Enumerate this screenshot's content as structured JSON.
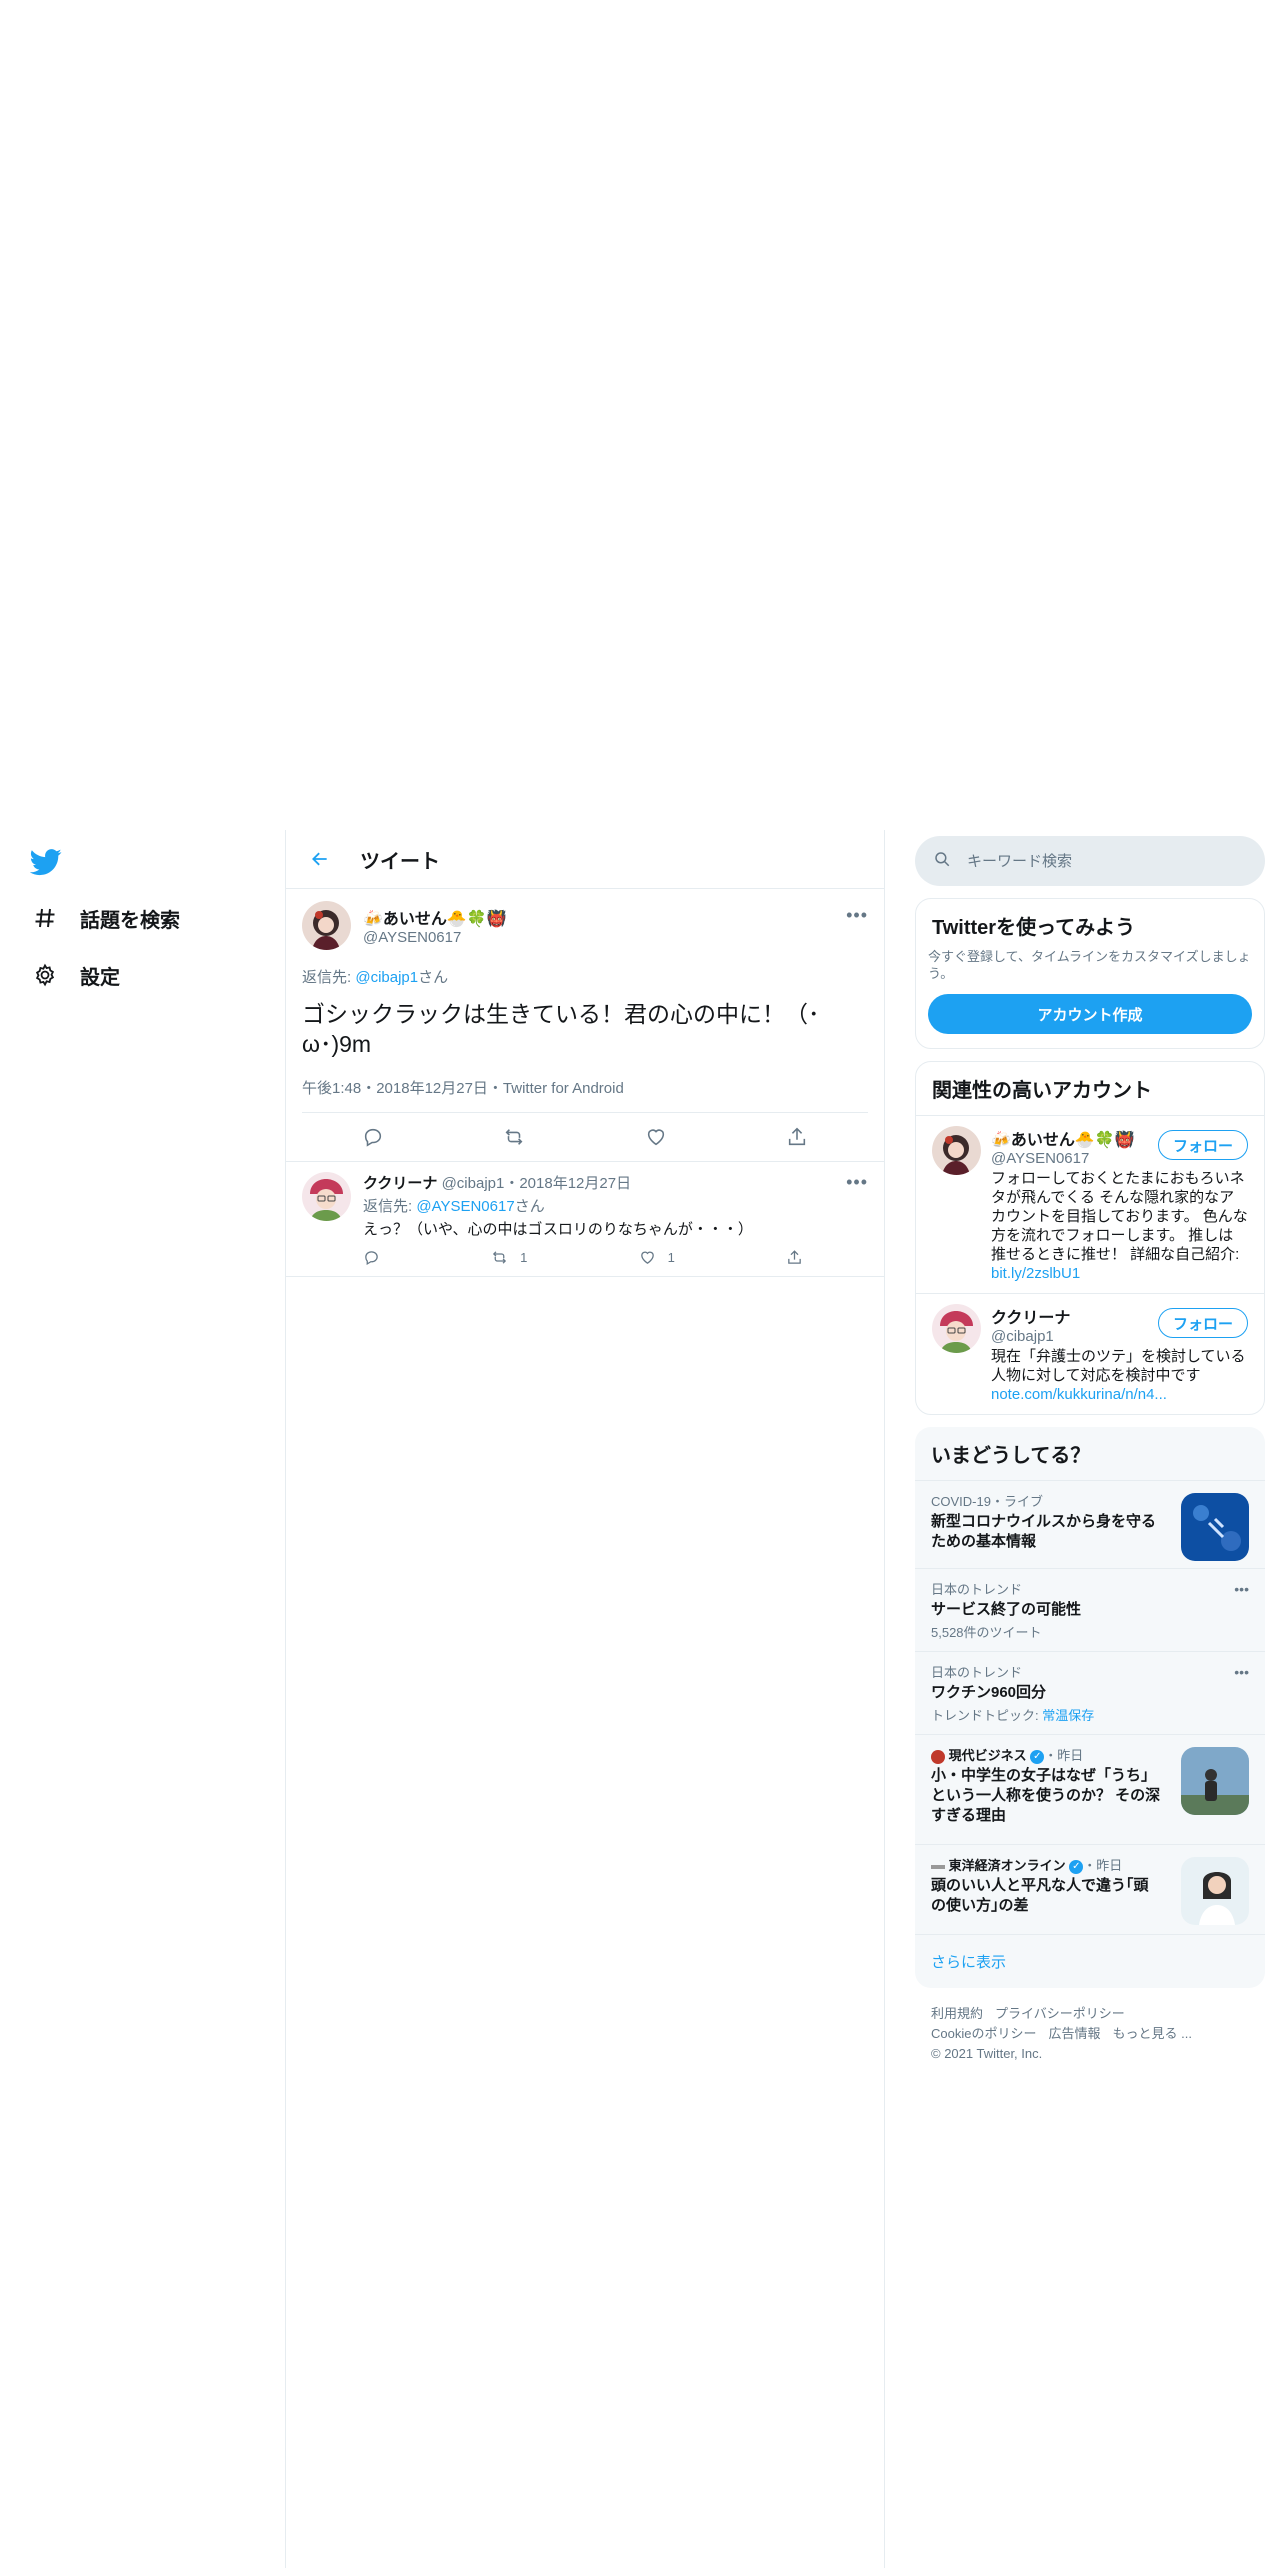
{
  "nav": {
    "explore_label": "話題を検索",
    "settings_label": "設定"
  },
  "header": {
    "title": "ツイート"
  },
  "main_tweet": {
    "name": "🍻あいせん🐣🍀👹",
    "handle": "@AYSEN0617",
    "reply_prefix": "返信先: ",
    "reply_user": "@cibajp1",
    "reply_suffix": "さん",
    "text": "ゴシックラックは生きている！君の心の中に！（･ω･)9m",
    "meta": "午後1:48・2018年12月27日・Twitter for Android"
  },
  "reply_tweet": {
    "name": "ククリーナ",
    "handle": "@cibajp1",
    "date": "・2018年12月27日",
    "reply_prefix": "返信先: ",
    "reply_user": "@AYSEN0617",
    "reply_suffix": "さん",
    "text": "えっ？（いや、心の中はゴスロリのりなちゃんが・・・）",
    "retweets": "1",
    "likes": "1"
  },
  "search": {
    "placeholder": "キーワード検索"
  },
  "signup": {
    "title": "Twitterを使ってみよう",
    "desc": "今すぐ登録して、タイムラインをカスタマイズしましょう。",
    "button": "アカウント作成"
  },
  "relevant": {
    "title": "関連性の高いアカウント",
    "follow_label": "フォロー",
    "accounts": [
      {
        "name": "🍻あいせん🐣🍀👹",
        "handle": "@AYSEN0617",
        "bio": "フォローしておくとたまにおもろいネタが飛んでくる そんな隠れ家的なアカウントを目指しております。 色んな方を流れでフォローします。 推しは推せるときに推せ！ 詳細な自己紹介: ",
        "link": "bit.ly/2zslbU1"
      },
      {
        "name": "ククリーナ",
        "handle": "@cibajp1",
        "bio": "現在「弁護士のツテ」を検討している人物に対して対応を検討中です",
        "link": "note.com/kukkurina/n/n4..."
      }
    ]
  },
  "trends": {
    "title": "いまどうしてる？",
    "items": [
      {
        "meta": "COVID-19・ライブ",
        "title": "新型コロナウイルスから身を守るための基本情報",
        "sub": ""
      },
      {
        "meta": "日本のトレンド",
        "title": "サービス終了の可能性",
        "sub": "5,528件のツイート"
      },
      {
        "meta": "日本のトレンド",
        "title": "ワクチン960回分",
        "sub_prefix": "トレンドトピック: ",
        "sub_link": "常温保存"
      },
      {
        "source": "現代ビジネス",
        "time": "・昨日",
        "title": "小・中学生の女子はなぜ「うち」という一人称を使うのか？ その深すぎる理由"
      },
      {
        "source": "東洋経済オンライン",
        "time": "・昨日",
        "title": "頭のいい人と平凡な人で違う｢頭の使い方｣の差"
      }
    ],
    "show_more": "さらに表示"
  },
  "footer": {
    "terms": "利用規約",
    "privacy": "プライバシーポリシー",
    "cookies": "Cookieのポリシー",
    "ads": "広告情報",
    "more": "もっと見る ...",
    "copyright": "© 2021 Twitter, Inc."
  },
  "colors": {
    "accent": "#1da1f2",
    "muted": "#657786",
    "border": "#e6ecf0"
  }
}
